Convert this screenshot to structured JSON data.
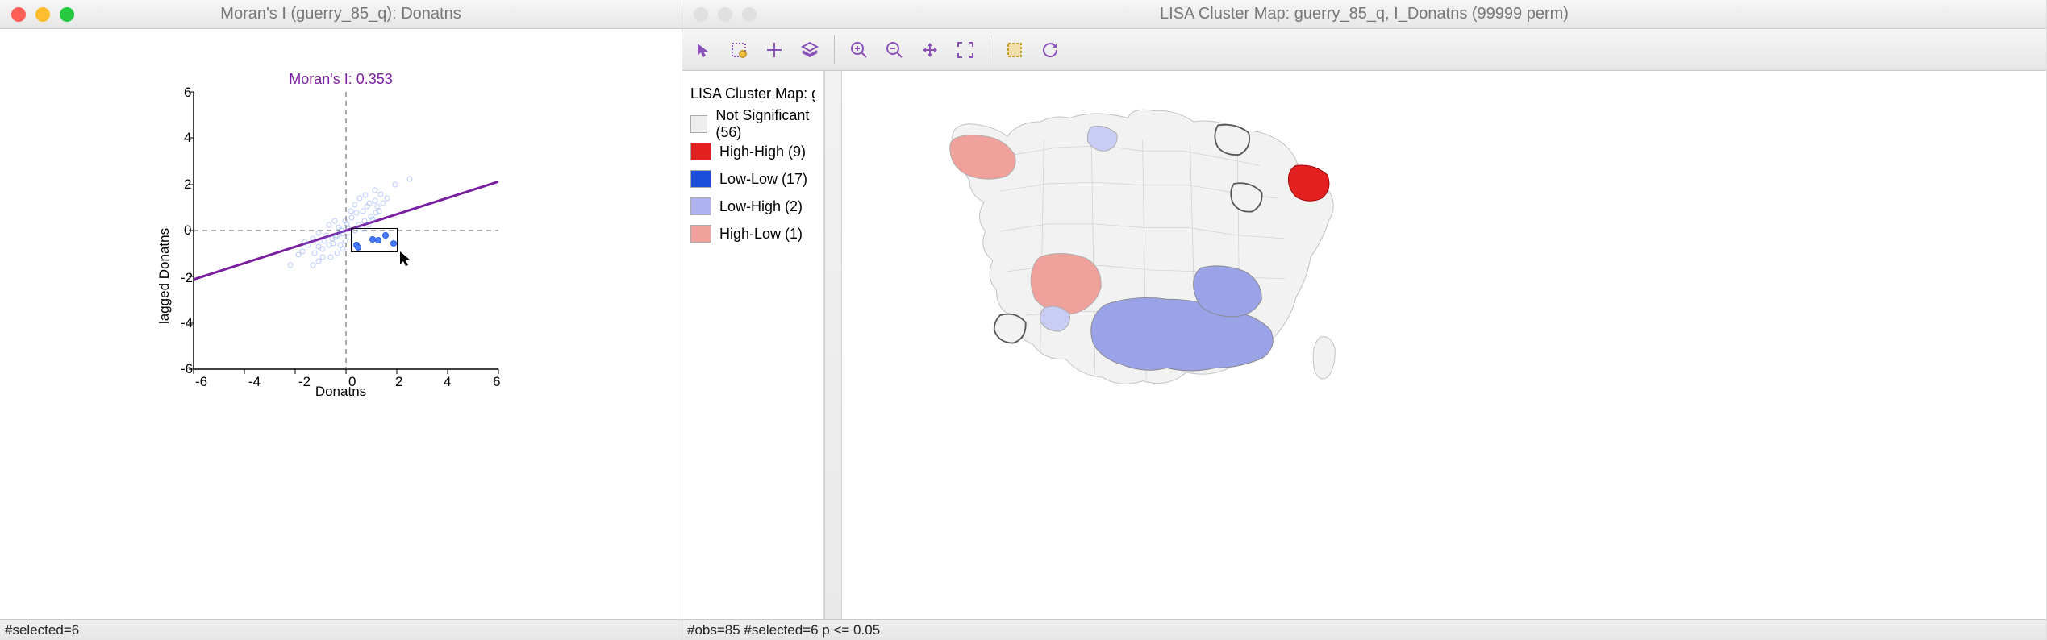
{
  "left_window": {
    "title": "Moran's I (guerry_85_q): Donatns",
    "moran_label": "Moran's I: 0.353",
    "xlabel": "Donatns",
    "ylabel": "lagged Donatns",
    "status": "#selected=6",
    "ticks_x": [
      "-6",
      "-4",
      "-2",
      "0",
      "2",
      "4",
      "6"
    ],
    "ticks_y": [
      "-6",
      "-4",
      "-2",
      "0",
      "2",
      "4",
      "6"
    ]
  },
  "right_window": {
    "title": "LISA Cluster Map: guerry_85_q, I_Donatns (99999 perm)",
    "legend_title": "LISA Cluster Map: guerry",
    "legend_items": [
      {
        "label": "Not Significant (56)",
        "color": "#eeeeee",
        "border": "#aaa"
      },
      {
        "label": "High-High (9)",
        "color": "#e22020"
      },
      {
        "label": "Low-Low (17)",
        "color": "#1b4edb"
      },
      {
        "label": "Low-High (2)",
        "color": "#aeb3ef"
      },
      {
        "label": "High-Low (1)",
        "color": "#f0a19c"
      }
    ],
    "status": "#obs=85 #selected=6   p <= 0.05"
  },
  "chart_data": {
    "type": "scatter",
    "title": "Moran's I: 0.353",
    "xlabel": "Donatns",
    "ylabel": "lagged Donatns",
    "xlim": [
      -6,
      6
    ],
    "ylim": [
      -6,
      6
    ],
    "reference_lines": {
      "x": 0,
      "y": 0
    },
    "fit_line": {
      "slope": 0.353,
      "intercept": 0
    },
    "selection_box": {
      "xmin": 0.15,
      "xmax": 2.05,
      "ymin": -1.0,
      "ymax": -0.1
    },
    "selected_points": [
      {
        "x": 0.42,
        "y": -0.62
      },
      {
        "x": 0.48,
        "y": -0.72
      },
      {
        "x": 1.05,
        "y": -0.38
      },
      {
        "x": 1.28,
        "y": -0.42
      },
      {
        "x": 1.55,
        "y": -0.22
      },
      {
        "x": 1.88,
        "y": -0.55
      }
    ],
    "background_points_note": "~79 unselected faint points clustered mostly in (-2..2,-2..2)"
  },
  "toolbar_icons": [
    "pointer",
    "select-rect",
    "pan-cross",
    "layers",
    "zoom-in",
    "zoom-out",
    "pan-move",
    "full-extent",
    "brush-rect",
    "refresh"
  ]
}
